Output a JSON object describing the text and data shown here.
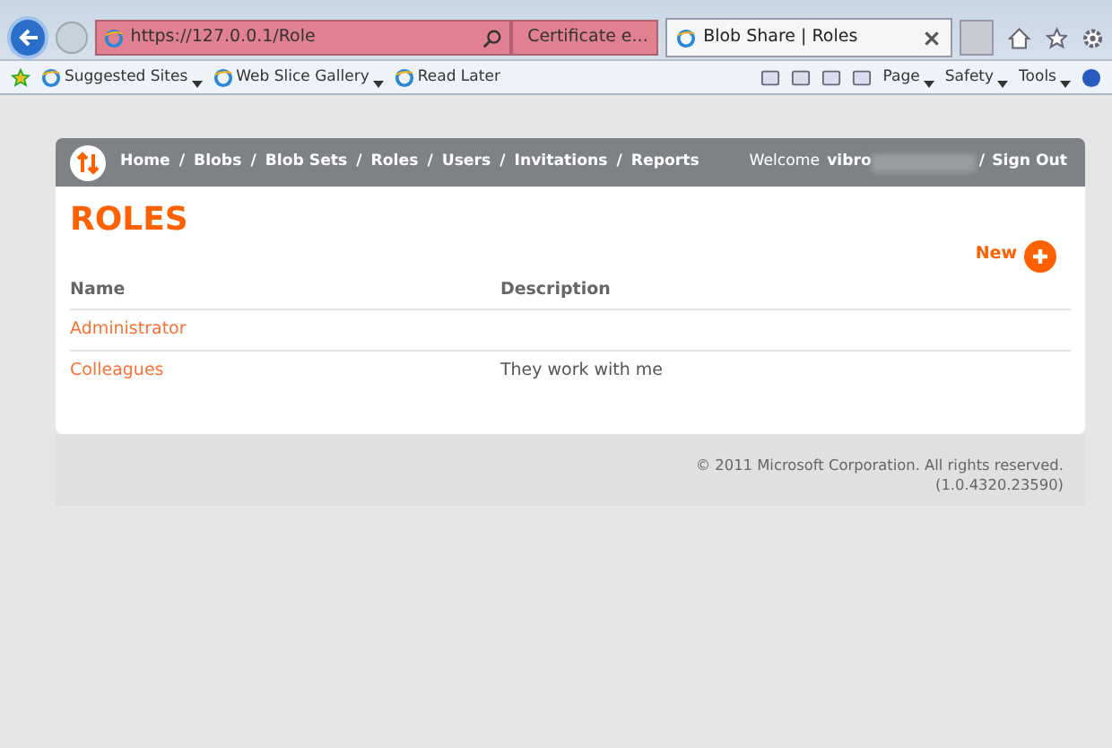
{
  "browser": {
    "address": "https://127.0.0.1/Role",
    "tabs": [
      {
        "label": "Certificate e...",
        "selected": false
      },
      {
        "label": "Blob Share | Roles",
        "selected": true
      }
    ],
    "favorites": [
      "Suggested Sites",
      "Web Slice Gallery",
      "Read Later"
    ],
    "commands": [
      "Page",
      "Safety",
      "Tools"
    ]
  },
  "nav": {
    "links": [
      "Home",
      "Blobs",
      "Blob Sets",
      "Roles",
      "Users",
      "Invitations",
      "Reports"
    ],
    "separator": "/",
    "welcome": "Welcome",
    "user": "vibro",
    "sign_out": "Sign Out"
  },
  "page": {
    "title": "ROLES",
    "new_label": "New"
  },
  "table": {
    "columns": [
      "Name",
      "Description"
    ],
    "rows": [
      {
        "name": "Administrator",
        "description": ""
      },
      {
        "name": "Colleagues",
        "description": "They work with me"
      }
    ]
  },
  "footer": {
    "copyright": "© 2011 Microsoft Corporation. All rights reserved.",
    "version": "(1.0.4320.23590)"
  }
}
